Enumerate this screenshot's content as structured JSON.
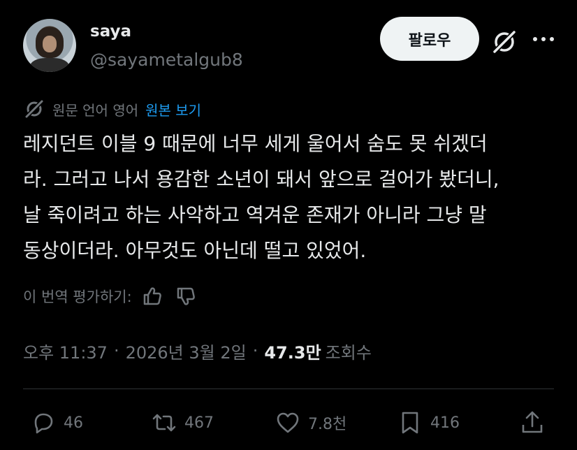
{
  "author": {
    "name": "saya",
    "handle": "@sayametalgub8"
  },
  "header": {
    "follow_label": "팔로우"
  },
  "translation": {
    "notice": "원문 언어 영어",
    "show_original": "원본 보기"
  },
  "tweet": {
    "text": "레지던트 이블 9 때문에 너무 세게 울어서 숨도 못 쉬겠더\n라. 그러고 나서 용감한 소년이 돼서 앞으로 걸어가 봤더니,\n날 죽이려고 하는 사악하고 역겨운 존재가 아니라 그냥 말\n동상이더라. 아무것도 아닌데 떨고 있었어."
  },
  "rating": {
    "label": "이 번역 평가하기:"
  },
  "meta": {
    "time": "오후 11:37",
    "separator": "·",
    "date": "2026년 3월 2일",
    "views_count": "47.3만",
    "views_label": "조회수"
  },
  "actions": {
    "replies": "46",
    "reposts": "467",
    "likes": "7.8천",
    "bookmarks": "416"
  },
  "colors": {
    "background": "#000000",
    "text": "#e7e9ea",
    "muted": "#71767b",
    "link": "#1d9bf0",
    "follow_bg": "#eff3f4"
  }
}
